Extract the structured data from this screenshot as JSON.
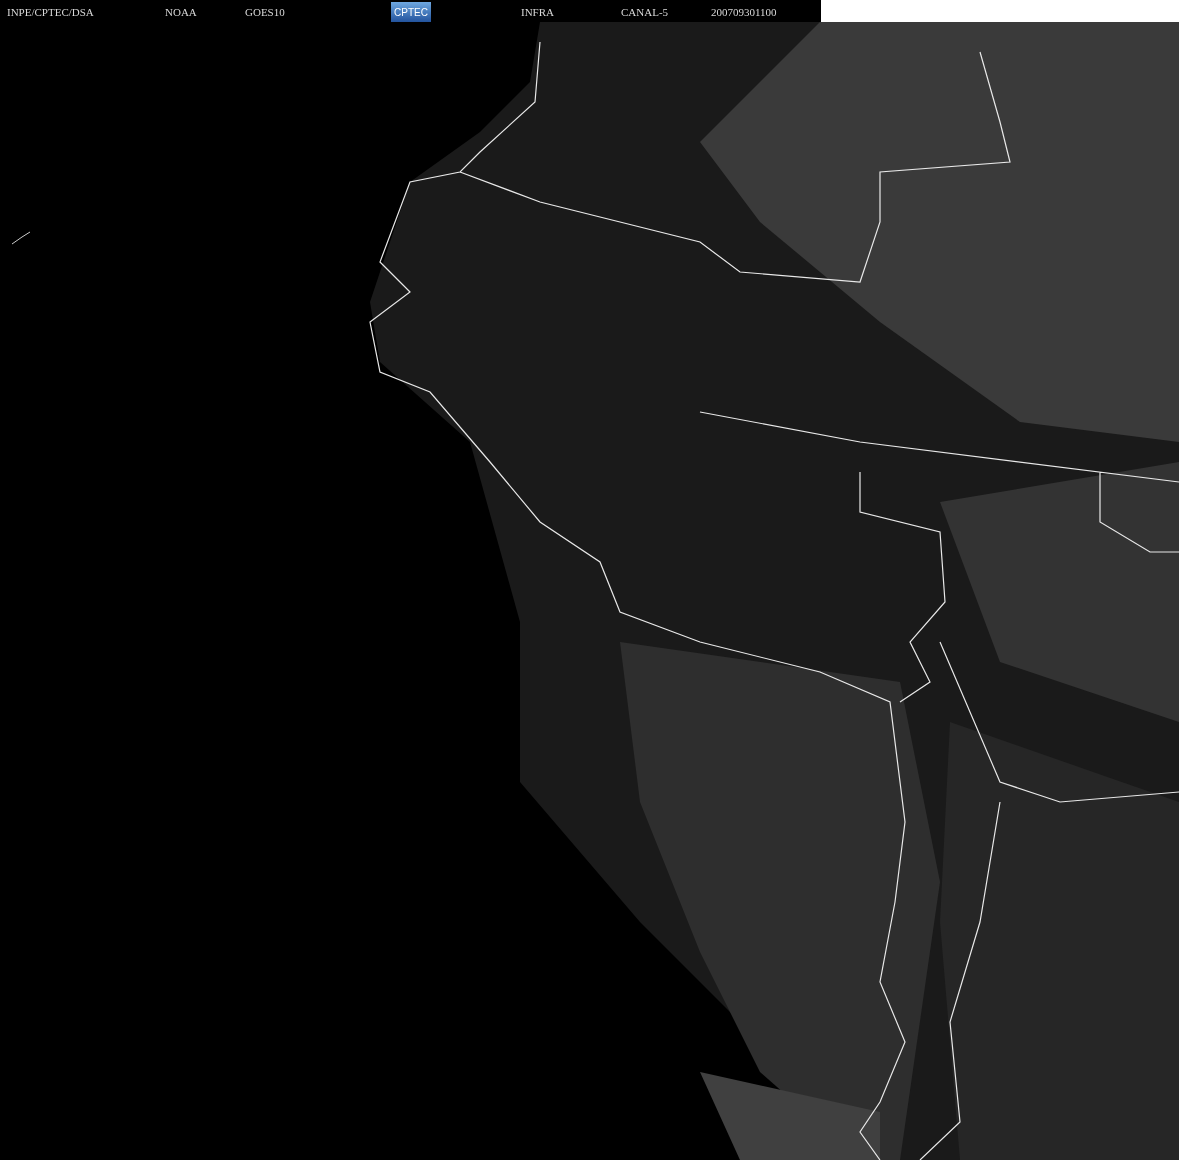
{
  "header": {
    "source": "INPE/CPTEC/DSA",
    "agency": "NOAA",
    "satellite": "GOES10",
    "logo": "CPTEC",
    "product": "INFRA",
    "channel": "CANAL-5",
    "timestamp": "200709301100"
  }
}
